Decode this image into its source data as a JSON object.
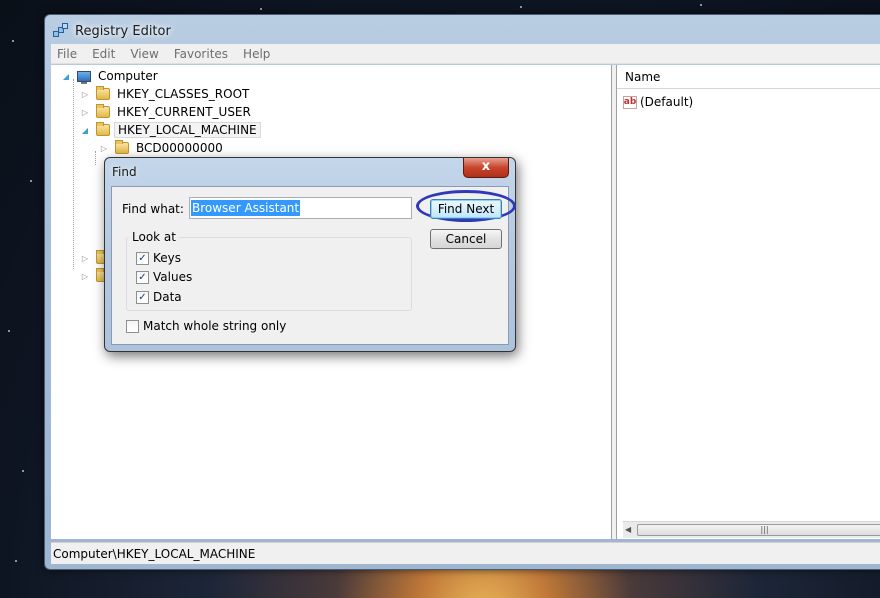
{
  "window": {
    "title": "Registry Editor"
  },
  "menu": [
    "File",
    "Edit",
    "View",
    "Favorites",
    "Help"
  ],
  "tree": {
    "root": "Computer",
    "items": [
      "HKEY_CLASSES_ROOT",
      "HKEY_CURRENT_USER",
      "HKEY_LOCAL_MACHINE"
    ],
    "child": "BCD00000000"
  },
  "list": {
    "column_name": "Name",
    "rows": [
      "(Default)"
    ]
  },
  "status": {
    "path": "Computer\\HKEY_LOCAL_MACHINE"
  },
  "find": {
    "title": "Find",
    "close": "x",
    "find_what_label": "Find what:",
    "find_what_value": "Browser Assistant",
    "find_next": "Find Next",
    "cancel": "Cancel",
    "look_at": "Look at",
    "keys": "Keys",
    "values": "Values",
    "data": "Data",
    "match_whole": "Match whole string only",
    "check_mark": "✓"
  },
  "colors": {
    "annotation_circle": "#2f38b8",
    "selection": "#3399ff"
  }
}
